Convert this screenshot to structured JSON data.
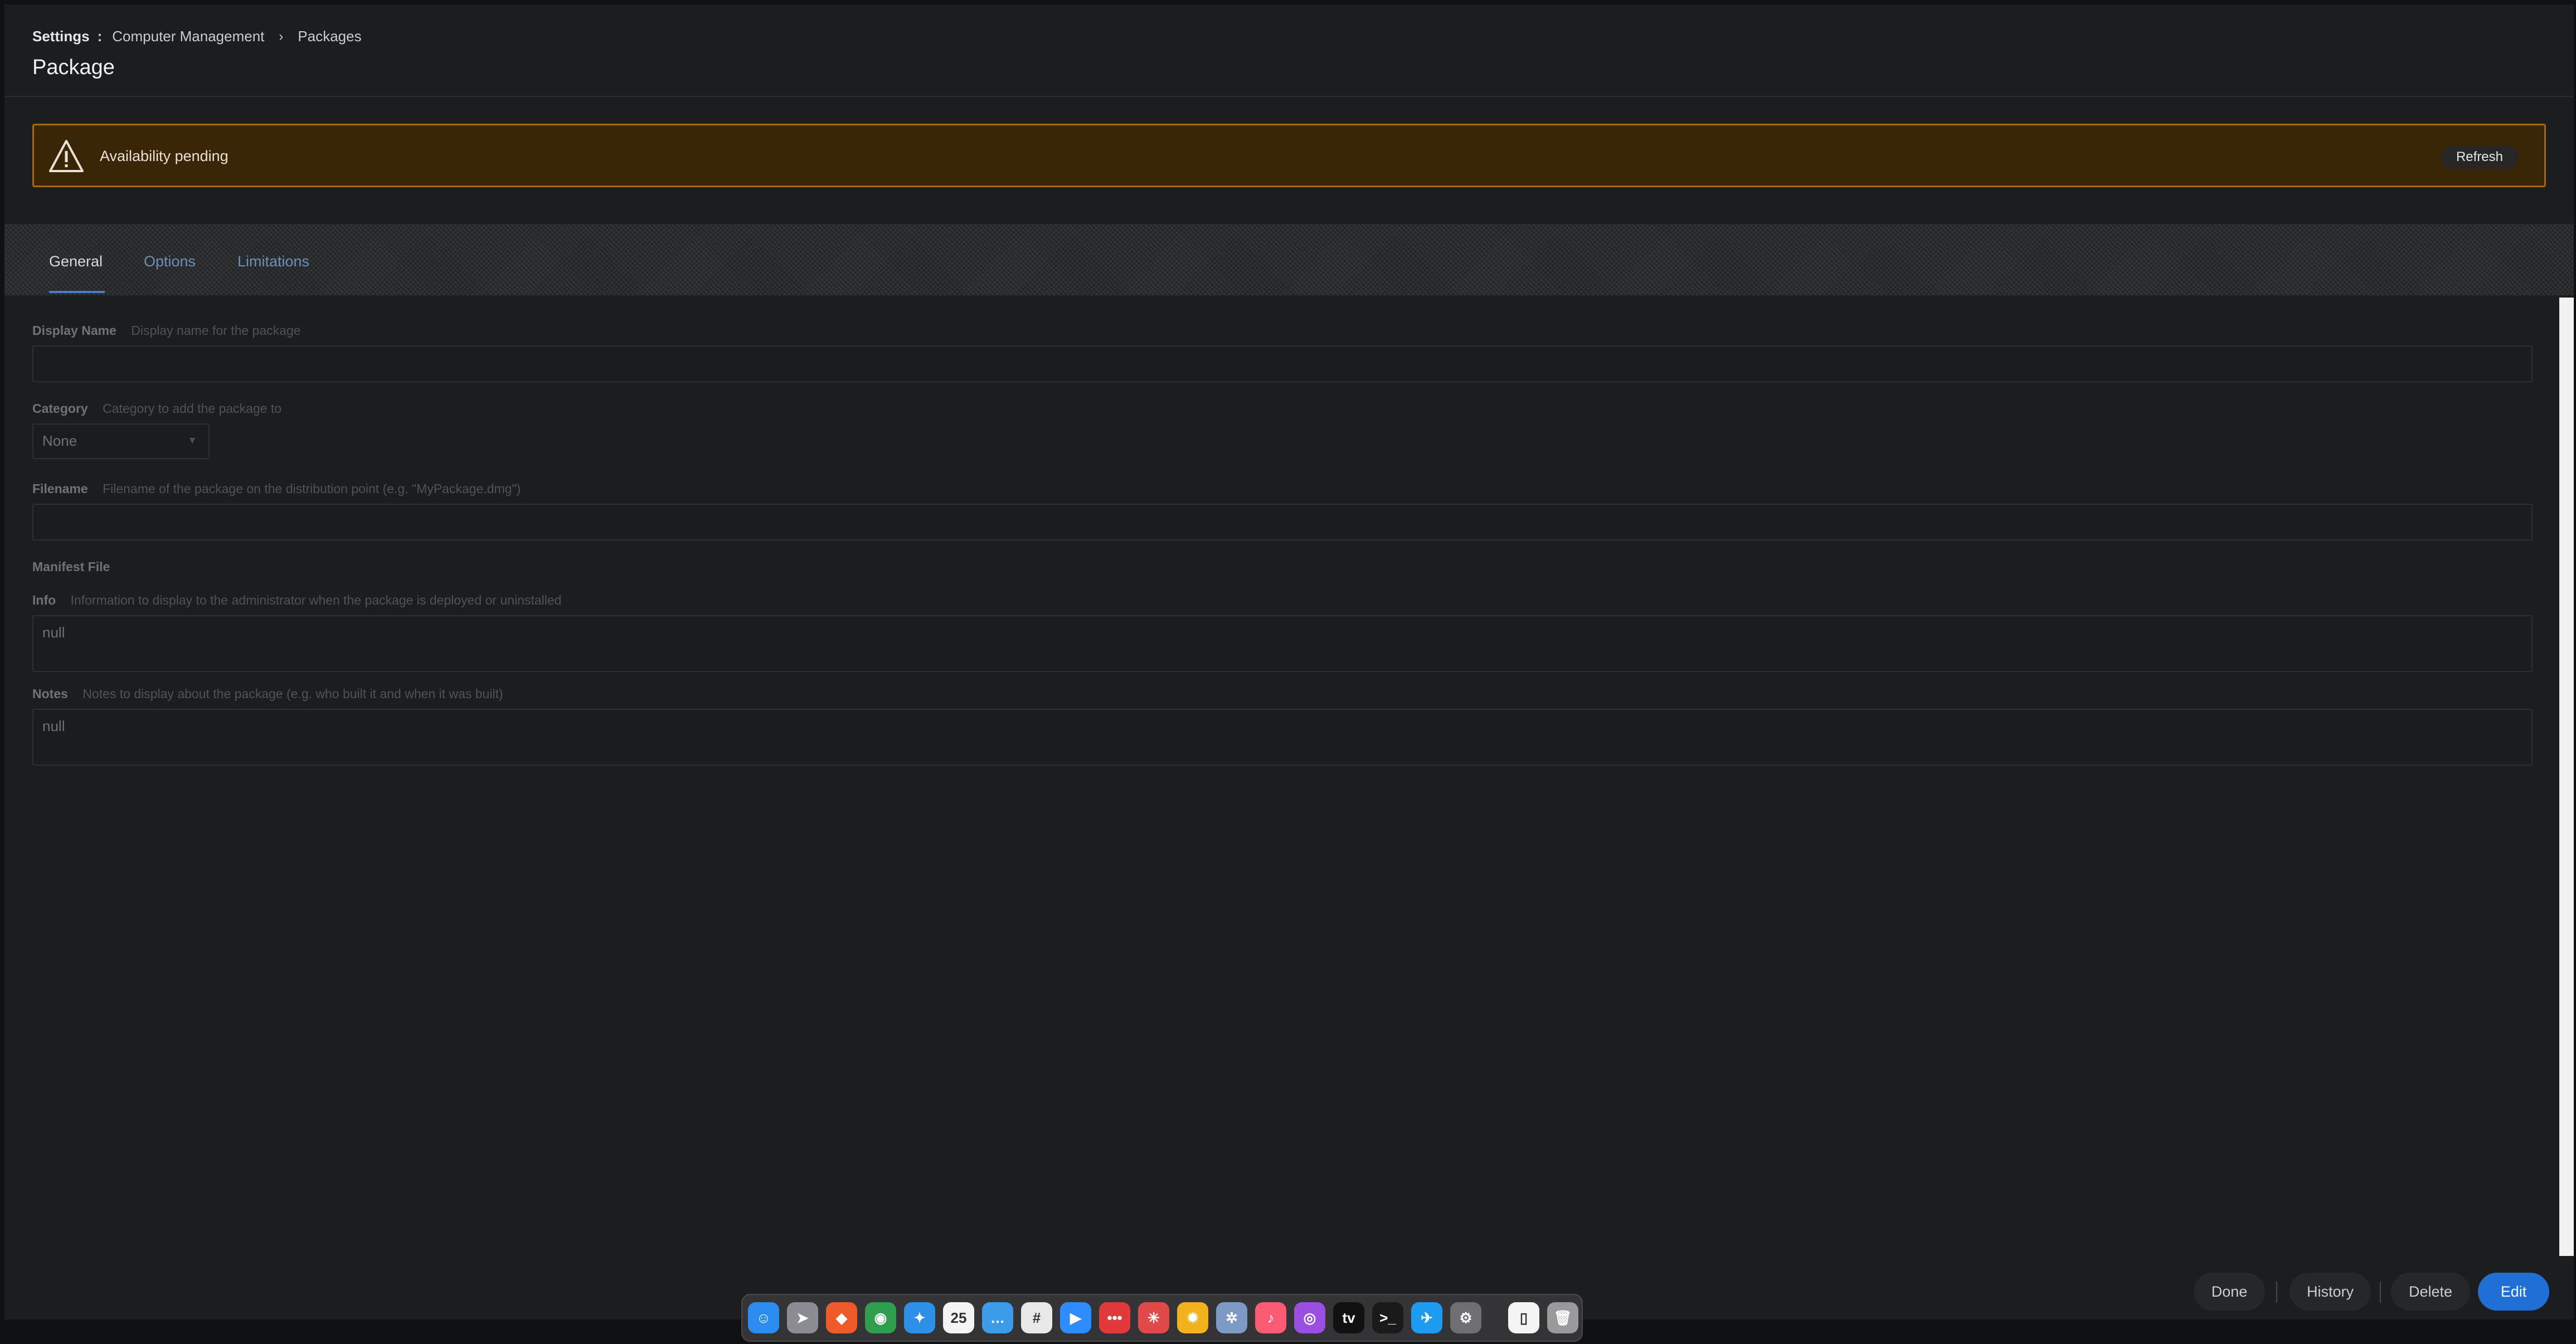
{
  "breadcrumb": {
    "root": "Settings",
    "separator": ":",
    "section": "Computer Management",
    "chevron": "›",
    "current": "Packages"
  },
  "page_title": "Package",
  "alert": {
    "icon": "warning-triangle-icon",
    "text": "Availability pending",
    "refresh_label": "Refresh",
    "bg_color": "#3a2506",
    "border_color": "#a46a06"
  },
  "tabs": [
    {
      "label": "General",
      "active": true
    },
    {
      "label": "Options",
      "active": false
    },
    {
      "label": "Limitations",
      "active": false
    }
  ],
  "form": {
    "display_name": {
      "label": "Display Name",
      "description": "Display name for the package",
      "value": ""
    },
    "category": {
      "label": "Category",
      "description": "Category to add the package to",
      "value": "None"
    },
    "filename": {
      "label": "Filename",
      "description": "Filename of the package on the distribution point (e.g. \"MyPackage.dmg\")",
      "value": ""
    },
    "manifest_file": {
      "label": "Manifest File"
    },
    "info": {
      "label": "Info",
      "description": "Information to display to the administrator when the package is deployed or uninstalled",
      "value": "null"
    },
    "notes": {
      "label": "Notes",
      "description": "Notes to display about the package (e.g. who built it and when it was built)",
      "value": "null"
    }
  },
  "footer": {
    "done_label": "Done",
    "history_label": "History",
    "delete_label": "Delete",
    "edit_label": "Edit",
    "accent_color": "#1f6fd6"
  },
  "dock": {
    "apps": [
      {
        "name": "finder-icon",
        "glyph": "☺",
        "color": "#2a8cf0"
      },
      {
        "name": "launchpad-icon",
        "glyph": "➤",
        "color": "#8a8d93"
      },
      {
        "name": "brave-icon",
        "glyph": "◆",
        "color": "#f05a28"
      },
      {
        "name": "chrome-icon",
        "glyph": "◉",
        "color": "#2f9e4f"
      },
      {
        "name": "safari-icon",
        "glyph": "✦",
        "color": "#2e8fe8"
      },
      {
        "name": "calendar-icon",
        "glyph": "25",
        "color": "#f4f4f4"
      },
      {
        "name": "messages-icon",
        "glyph": "…",
        "color": "#3d9be9"
      },
      {
        "name": "slack-icon",
        "glyph": "#",
        "color": "#e8e8e8"
      },
      {
        "name": "zoom-icon",
        "glyph": "▶",
        "color": "#2d8cff"
      },
      {
        "name": "dots-app-icon",
        "glyph": "•••",
        "color": "#e23a3a"
      },
      {
        "name": "spark-icon",
        "glyph": "✳",
        "color": "#e24a4a"
      },
      {
        "name": "sun-app-icon",
        "glyph": "✹",
        "color": "#f2b21b"
      },
      {
        "name": "gear-app-icon",
        "glyph": "✲",
        "color": "#7c9ac4"
      },
      {
        "name": "music-icon",
        "glyph": "♪",
        "color": "#fb5c74"
      },
      {
        "name": "podcasts-icon",
        "glyph": "◎",
        "color": "#9a4fe0"
      },
      {
        "name": "appletv-icon",
        "glyph": "tv",
        "color": "#111111"
      },
      {
        "name": "terminal-icon",
        "glyph": ">_",
        "color": "#1a1a1a"
      },
      {
        "name": "twitter-icon",
        "glyph": "✈",
        "color": "#1d9bf0"
      },
      {
        "name": "system-preferences-icon",
        "glyph": "⚙",
        "color": "#6e6e73"
      }
    ],
    "extras": [
      {
        "name": "document-icon",
        "glyph": "▯",
        "color": "#f4f4f4"
      },
      {
        "name": "trash-icon",
        "glyph": "🗑",
        "color": "#9a9a9e"
      }
    ]
  }
}
